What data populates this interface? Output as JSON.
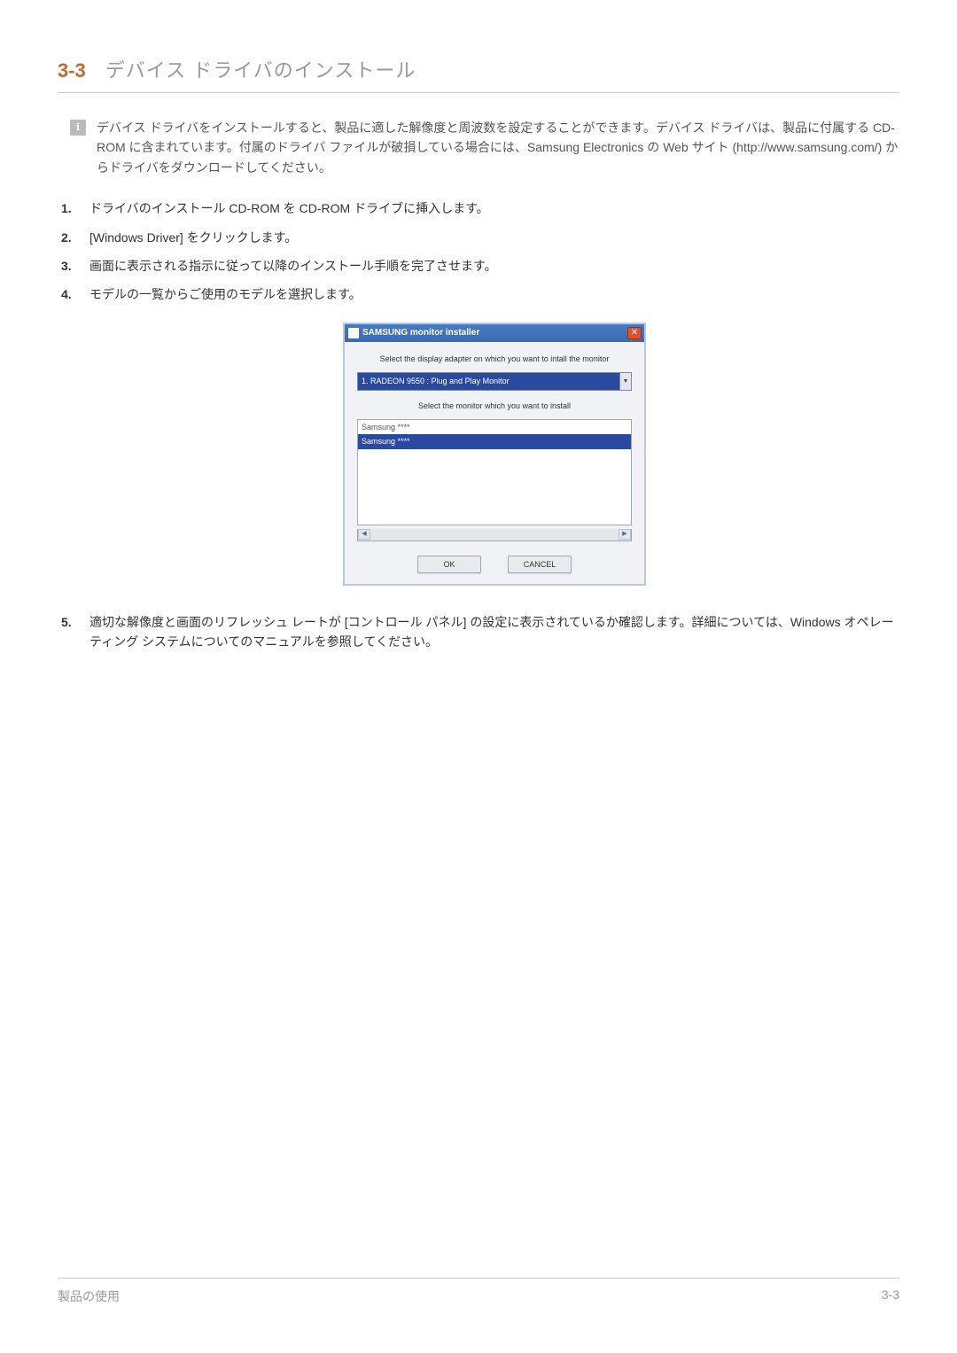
{
  "heading": {
    "number": "3-3",
    "title": "デバイス ドライバのインストール"
  },
  "note_icon": "ℹ",
  "note_text": "デバイス ドライバをインストールすると、製品に適した解像度と周波数を設定することができます。デバイス ドライバは、製品に付属する CD-ROM に含まれています。付属のドライバ ファイルが破損している場合には、Samsung Electronics の Web サイト (http://www.samsung.com/) からドライバをダウンロードしてください。",
  "steps": [
    "ドライバのインストール CD-ROM を CD-ROM ドライブに挿入します。",
    "[Windows Driver] をクリックします。",
    "画面に表示される指示に従って以降のインストール手順を完了させます。",
    "モデルの一覧からご使用のモデルを選択します。",
    "適切な解像度と画面のリフレッシュ レートが [コントロール パネル] の設定に表示されているか確認します。詳細については、Windows オペレーティング システムについてのマニュアルを参照してください。"
  ],
  "installer": {
    "title": "SAMSUNG monitor installer",
    "close": "✕",
    "label_adapter": "Select the display adapter on which you want to intall the monitor",
    "adapter_value": "1. RADEON 9550 : Plug and Play Monitor",
    "dropdown_glyph": "▼",
    "label_monitor": "Select the monitor which you want to install",
    "monitors": [
      "Samsung ****",
      "Samsung ****"
    ],
    "scroll_left": "◀",
    "scroll_right": "▶",
    "ok": "OK",
    "cancel": "CANCEL"
  },
  "footer": {
    "left": "製品の使用",
    "right": "3-3"
  }
}
